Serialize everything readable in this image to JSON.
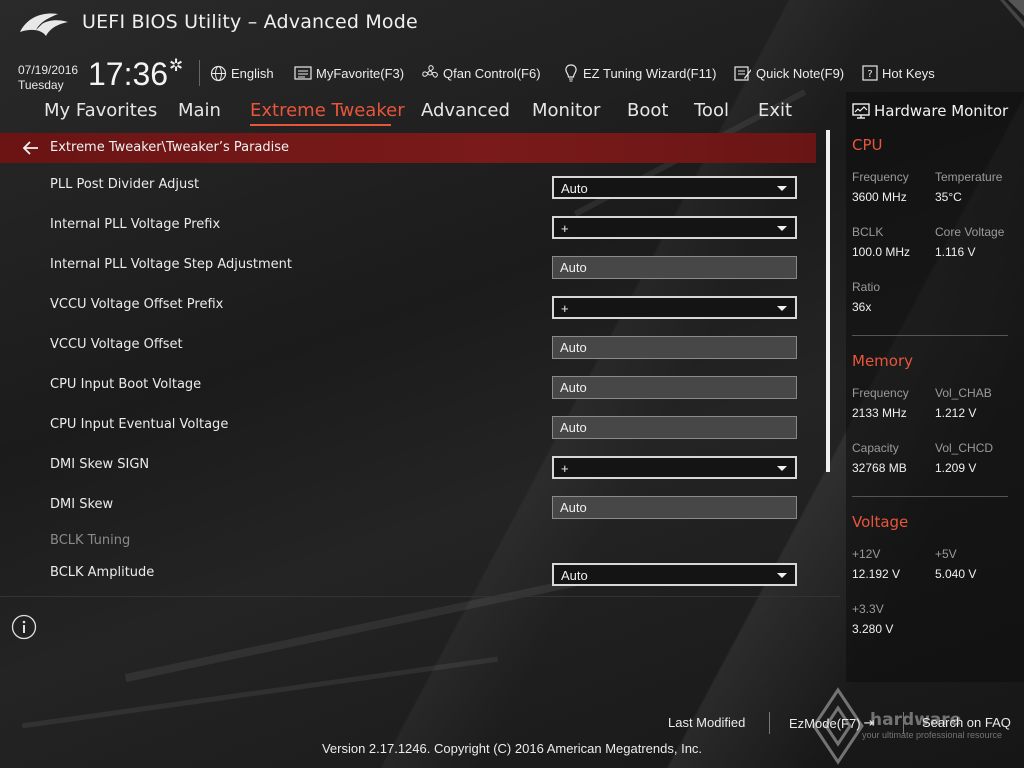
{
  "app": {
    "title": "UEFI BIOS Utility – Advanced Mode"
  },
  "infobar": {
    "date": "07/19/2016",
    "weekday": "Tuesday",
    "time": "17:36",
    "tools": [
      {
        "label": "English",
        "icon": "globe-icon"
      },
      {
        "label": "MyFavorite(F3)",
        "icon": "favorite-list-icon"
      },
      {
        "label": "Qfan Control(F6)",
        "icon": "fan-icon"
      },
      {
        "label": "EZ Tuning Wizard(F11)",
        "icon": "lightbulb-icon"
      },
      {
        "label": "Quick Note(F9)",
        "icon": "note-icon"
      },
      {
        "label": "Hot Keys",
        "icon": "question-icon"
      }
    ]
  },
  "nav": {
    "tabs": [
      "My Favorites",
      "Main",
      "Extreme Tweaker",
      "Advanced",
      "Monitor",
      "Boot",
      "Tool",
      "Exit"
    ],
    "active": "Extreme Tweaker"
  },
  "breadcrumb": "Extreme Tweaker\\Tweaker’s Paradise",
  "settings": [
    {
      "label": "PLL Post Divider Adjust",
      "value": "Auto",
      "control": "dropdown"
    },
    {
      "label": "Internal PLL Voltage Prefix",
      "value": "+",
      "control": "dropdown"
    },
    {
      "label": "Internal PLL Voltage Step Adjustment",
      "value": "Auto",
      "control": "textbox"
    },
    {
      "label": "VCCU Voltage Offset Prefix",
      "value": "+",
      "control": "dropdown"
    },
    {
      "label": "VCCU Voltage Offset",
      "value": "Auto",
      "control": "textbox"
    },
    {
      "label": "CPU Input Boot Voltage",
      "value": "Auto",
      "control": "textbox"
    },
    {
      "label": "CPU Input Eventual Voltage",
      "value": "Auto",
      "control": "textbox"
    },
    {
      "label": "DMI Skew SIGN",
      "value": "+",
      "control": "dropdown"
    },
    {
      "label": "DMI Skew",
      "value": "Auto",
      "control": "textbox"
    },
    {
      "label": "BCLK Tuning",
      "value": "",
      "control": "header"
    },
    {
      "label": "BCLK Amplitude",
      "value": "Auto",
      "control": "dropdown"
    }
  ],
  "hwmon": {
    "title": "Hardware Monitor",
    "cpu": {
      "title": "CPU",
      "frequency_label": "Frequency",
      "frequency": "3600 MHz",
      "temperature_label": "Temperature",
      "temperature": "35°C",
      "bclk_label": "BCLK",
      "bclk": "100.0 MHz",
      "core_voltage_label": "Core Voltage",
      "core_voltage": "1.116 V",
      "ratio_label": "Ratio",
      "ratio": "36x"
    },
    "memory": {
      "title": "Memory",
      "frequency_label": "Frequency",
      "frequency": "2133 MHz",
      "vol_chab_label": "Vol_CHAB",
      "vol_chab": "1.212 V",
      "capacity_label": "Capacity",
      "capacity": "32768 MB",
      "vol_chcd_label": "Vol_CHCD",
      "vol_chcd": "1.209 V"
    },
    "voltage": {
      "title": "Voltage",
      "v12_label": "+12V",
      "v12": "12.192 V",
      "v5_label": "+5V",
      "v5": "5.040 V",
      "v33_label": "+3.3V",
      "v33": "3.280 V"
    }
  },
  "footer": {
    "last_modified": "Last Modified",
    "ezmode": "EzMode(F7)",
    "search_faq": "Search on FAQ",
    "version": "Version 2.17.1246. Copyright (C) 2016 American Megatrends, Inc."
  },
  "watermark": {
    "brand": "hardware",
    "slogan": "your ultimate professional resource"
  },
  "colors": {
    "accent": "#e8553a",
    "breadcrumb_bg": "#731818"
  }
}
